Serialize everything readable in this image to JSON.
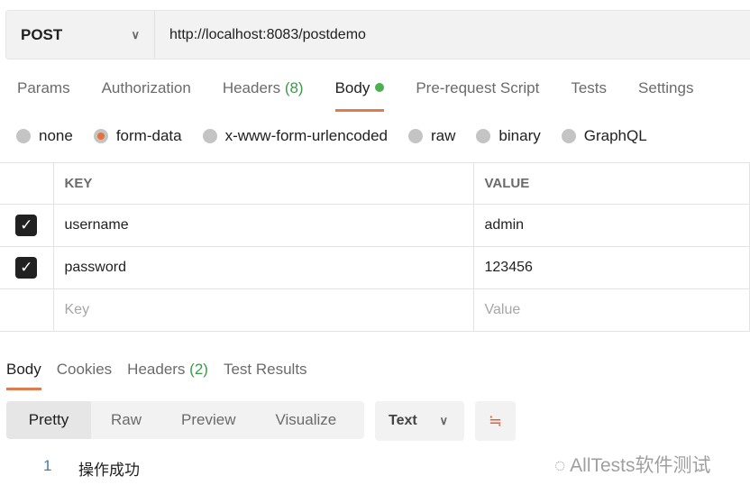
{
  "request": {
    "method": "POST",
    "url": "http://localhost:8083/postdemo"
  },
  "tabs": [
    {
      "label": "Params"
    },
    {
      "label": "Authorization"
    },
    {
      "label": "Headers",
      "count": "(8)"
    },
    {
      "label": "Body"
    },
    {
      "label": "Pre-request Script"
    },
    {
      "label": "Tests"
    },
    {
      "label": "Settings"
    }
  ],
  "body_types": [
    "none",
    "form-data",
    "x-www-form-urlencoded",
    "raw",
    "binary",
    "GraphQL"
  ],
  "selected_body_type": "form-data",
  "table": {
    "headers": [
      "KEY",
      "VALUE"
    ],
    "rows": [
      {
        "key": "username",
        "value": "admin",
        "checked": true
      },
      {
        "key": "password",
        "value": "123456",
        "checked": true
      }
    ],
    "key_placeholder": "Key",
    "value_placeholder": "Value"
  },
  "response": {
    "tabs": [
      {
        "label": "Body"
      },
      {
        "label": "Cookies"
      },
      {
        "label": "Headers",
        "count": "(2)"
      },
      {
        "label": "Test Results"
      }
    ],
    "views": [
      "Pretty",
      "Raw",
      "Preview",
      "Visualize"
    ],
    "format": "Text",
    "lines": [
      {
        "num": "1",
        "text": "操作成功"
      }
    ]
  },
  "watermark": "AllTests软件测试",
  "colors": {
    "accent": "#e07a4f",
    "green": "#4caf50"
  }
}
